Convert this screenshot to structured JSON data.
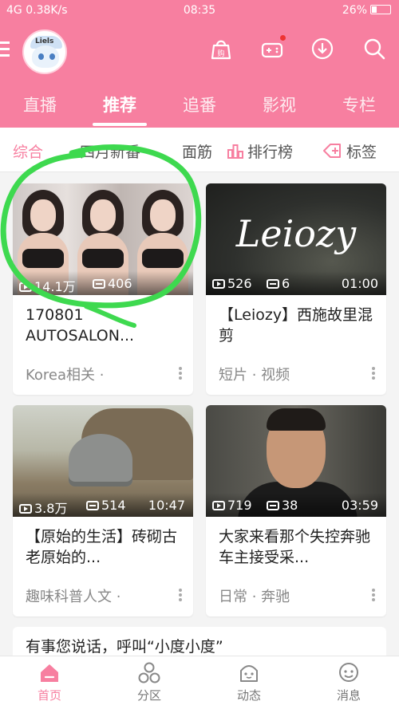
{
  "status_bar": {
    "left": "4G 0.38K/s",
    "time": "08:35",
    "battery": "26%"
  },
  "header": {
    "avatar_logo": "Liels",
    "icons": [
      "shop-bag-icon",
      "gamepad-icon",
      "download-icon",
      "search-icon"
    ]
  },
  "tabs": [
    {
      "label": "直播"
    },
    {
      "label": "推荐"
    },
    {
      "label": "追番"
    },
    {
      "label": "影视"
    },
    {
      "label": "专栏"
    }
  ],
  "filter": {
    "items": [
      "综合",
      "四月新番",
      "面筋"
    ],
    "ranking_label": "排行榜",
    "tags_label": "标签"
  },
  "cards": [
    {
      "views": "14.1万",
      "danmaku": "406",
      "duration": "",
      "title": "170801 AUTOSALON...",
      "meta": "Korea相关 ·"
    },
    {
      "views": "526",
      "danmaku": "6",
      "duration": "01:00",
      "thumb_text": "Leiozy",
      "title": "【Leiozy】西施故里混剪",
      "meta": "短片 · 视频"
    },
    {
      "views": "3.8万",
      "danmaku": "514",
      "duration": "10:47",
      "title": "【原始的生活】砖砌古老原始的...",
      "meta": "趣味科普人文 ·"
    },
    {
      "views": "719",
      "danmaku": "38",
      "duration": "03:59",
      "title": "大家来看那个失控奔驰车主接受采...",
      "meta": "日常 · 奔驰"
    }
  ],
  "banner": {
    "text": "有事您说话，呼叫“小度小度”"
  },
  "bottom_nav": [
    {
      "label": "首页"
    },
    {
      "label": "分区"
    },
    {
      "label": "动态"
    },
    {
      "label": "消息"
    }
  ],
  "colors": {
    "accent": "#f77fa0",
    "annotation": "#3ed94f"
  }
}
